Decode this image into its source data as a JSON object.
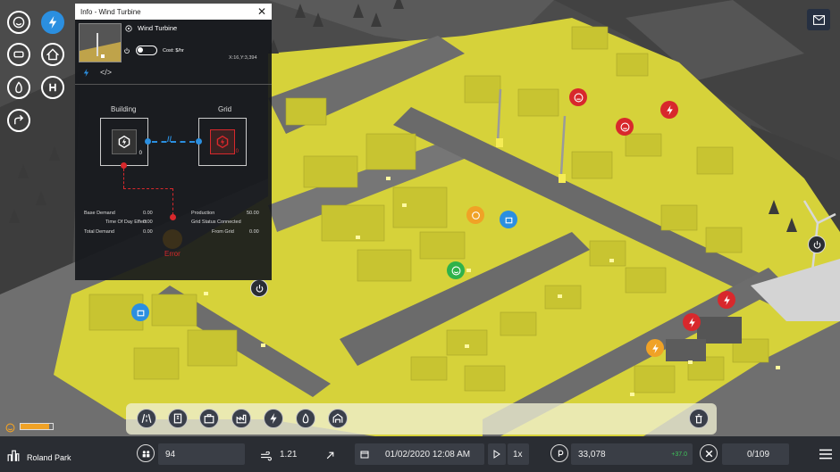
{
  "colors": {
    "district": "#d6d23a",
    "road": "#6d6d6d",
    "accent": "#2b8fe0",
    "alert": "#d8282c",
    "ok": "#2fb24a",
    "warn": "#f0a226"
  },
  "info_panel": {
    "title": "Info - Wind Turbine",
    "name": "Wind Turbine",
    "cost": "Cost: $/hr",
    "coords": "X:16,Y:3,394",
    "building_label": "Building",
    "grid_label": "Grid",
    "building_value": "0",
    "grid_value": "0",
    "error_label": "Error",
    "stats_left": [
      {
        "label": "Base Demand",
        "value": "0.00"
      },
      {
        "label": "Time Of Day Effect",
        "value": "0.00"
      },
      {
        "label": "Total Demand",
        "value": "0.00"
      }
    ],
    "stats_right": [
      {
        "label": "Production",
        "value": "50.00"
      },
      {
        "label": "Grid Status",
        "value": "Connected"
      },
      {
        "label": "From Grid",
        "value": "0.00"
      }
    ]
  },
  "left_tools": [
    "happiness-icon",
    "power-icon",
    "car-icon",
    "house-icon",
    "fire-icon",
    "hospital-icon",
    "share-icon"
  ],
  "toolbar_tools": [
    "road-icon",
    "building-icon",
    "briefcase-icon",
    "factory-icon",
    "power-icon",
    "fire-icon",
    "utility-icon",
    "delete-icon"
  ],
  "status": {
    "district": "Roland Park",
    "happiness_level": 0.9,
    "shelter_level": 0.25,
    "population": "94",
    "wind": "1.21",
    "datetime": "01/02/2020 12:08 AM",
    "speed": "1x",
    "money": "33,078",
    "money_delta": "+37.0",
    "workers": "0/109"
  }
}
